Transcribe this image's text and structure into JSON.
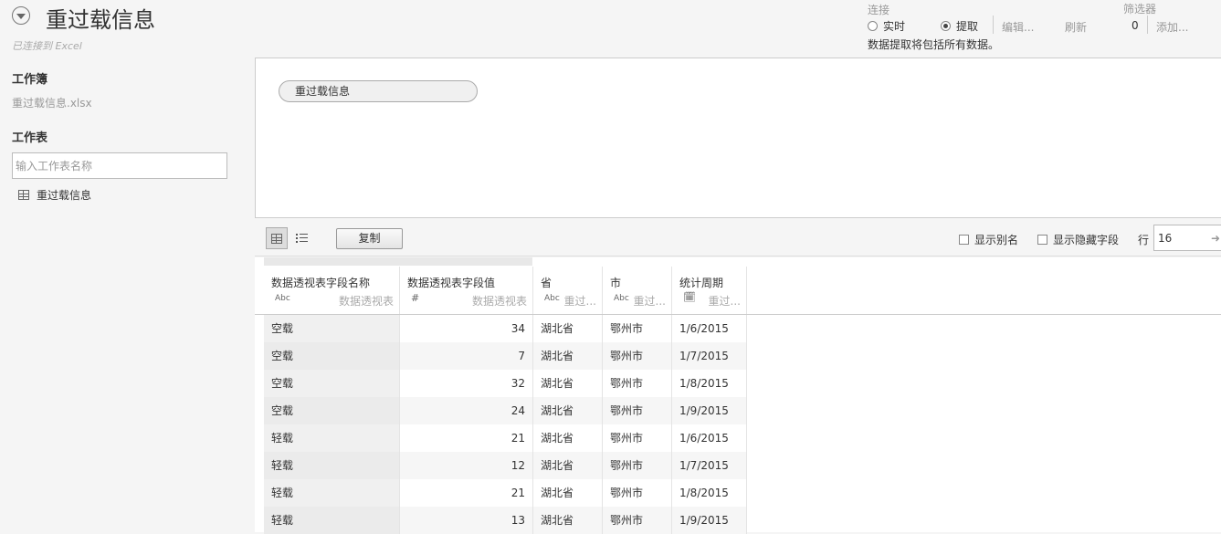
{
  "header": {
    "title": "重过载信息",
    "subtitle": "已连接到 Excel"
  },
  "connection": {
    "label": "连接",
    "live": "实时",
    "extract": "提取",
    "selected": "extract",
    "edit": "编辑...",
    "refresh": "刷新",
    "note": "数据提取将包括所有数据。"
  },
  "filters": {
    "label": "筛选器",
    "count": "0",
    "add": "添加..."
  },
  "sidebar": {
    "workbook_heading": "工作簿",
    "workbook_file": "重过载信息.xlsx",
    "sheets_heading": "工作表",
    "sheet_search_placeholder": "输入工作表名称",
    "sheets": [
      "重过载信息"
    ]
  },
  "canvas": {
    "table_pill": "重过载信息"
  },
  "toolbar": {
    "copy": "复制",
    "show_aliases": "显示别名",
    "show_hidden": "显示隐藏字段",
    "rows_label": "行",
    "rows_value": "16"
  },
  "grid": {
    "columns": [
      {
        "name": "数据透视表字段名称",
        "type": "Abc",
        "source": "数据透视表"
      },
      {
        "name": "数据透视表字段值",
        "type": "#",
        "source": "数据透视表"
      },
      {
        "name": "省",
        "type": "Abc",
        "source": "重过..."
      },
      {
        "name": "市",
        "type": "Abc",
        "source": "重过..."
      },
      {
        "name": "统计周期",
        "type": "date",
        "source": "重过..."
      }
    ],
    "rows": [
      [
        "空载",
        "34",
        "湖北省",
        "鄂州市",
        "1/6/2015"
      ],
      [
        "空载",
        "7",
        "湖北省",
        "鄂州市",
        "1/7/2015"
      ],
      [
        "空载",
        "32",
        "湖北省",
        "鄂州市",
        "1/8/2015"
      ],
      [
        "空载",
        "24",
        "湖北省",
        "鄂州市",
        "1/9/2015"
      ],
      [
        "轻载",
        "21",
        "湖北省",
        "鄂州市",
        "1/6/2015"
      ],
      [
        "轻载",
        "12",
        "湖北省",
        "鄂州市",
        "1/7/2015"
      ],
      [
        "轻载",
        "21",
        "湖北省",
        "鄂州市",
        "1/8/2015"
      ],
      [
        "轻载",
        "13",
        "湖北省",
        "鄂州市",
        "1/9/2015"
      ]
    ]
  }
}
